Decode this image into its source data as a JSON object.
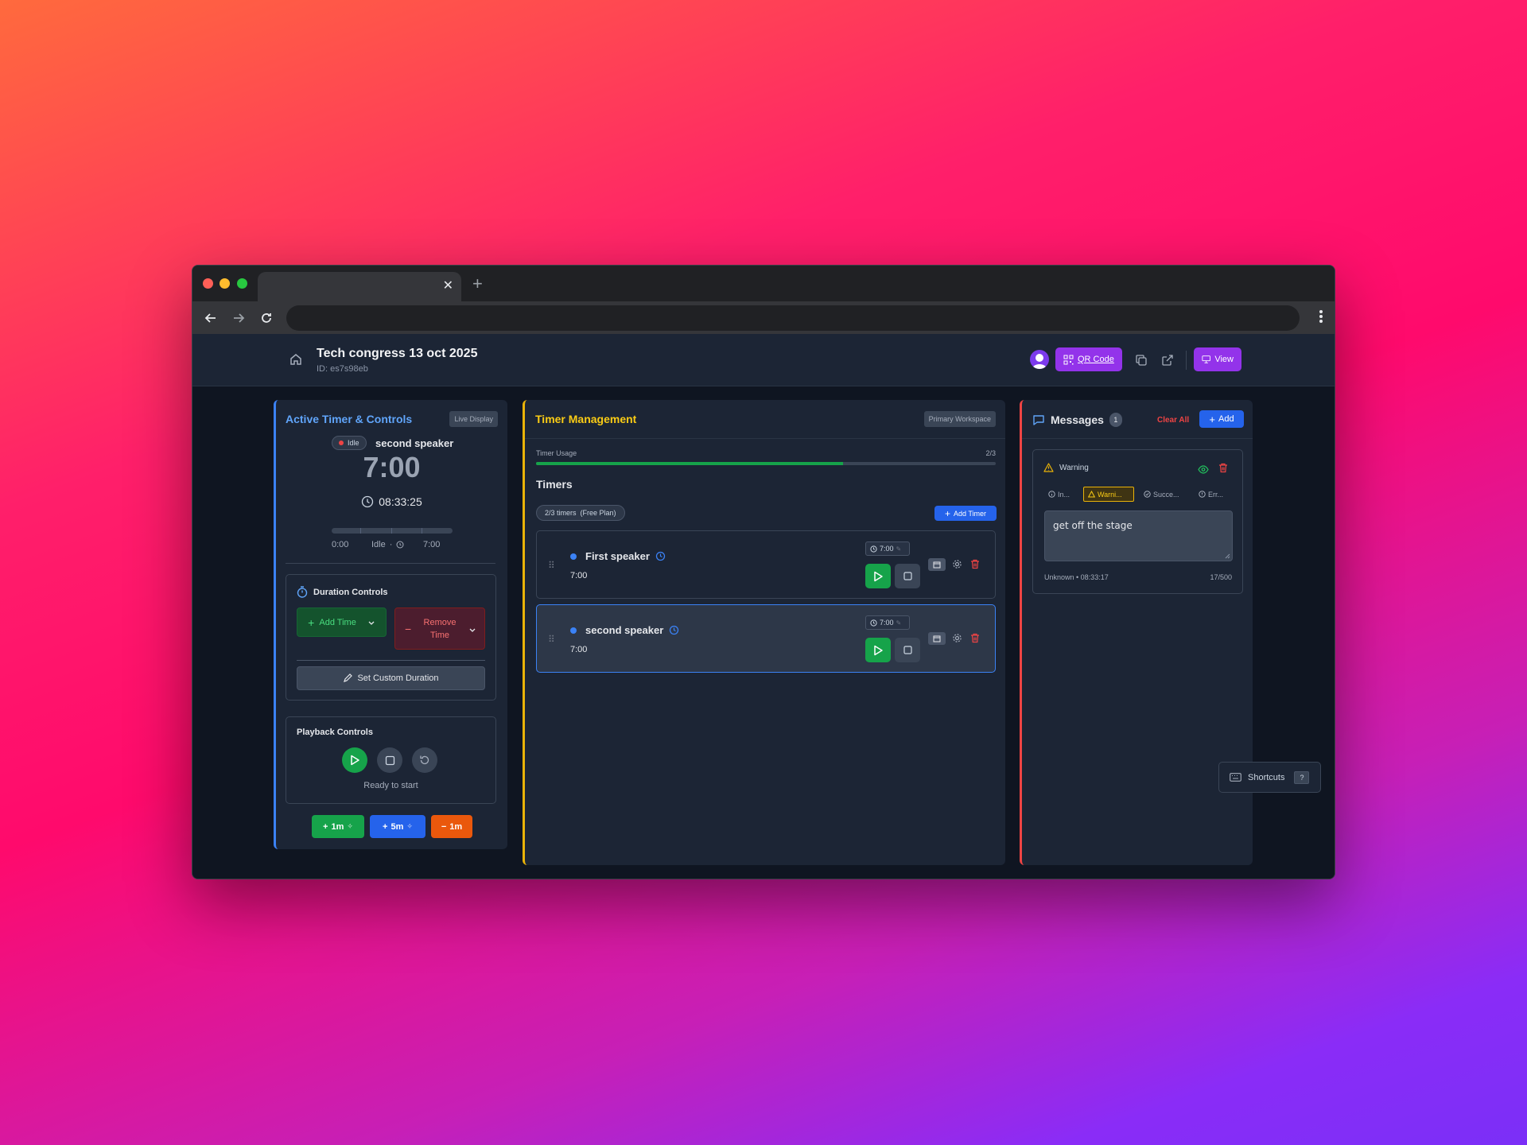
{
  "browser": {
    "tab_close": "✕",
    "new_tab": "+"
  },
  "header": {
    "event_title": "Tech congress 13 oct 2025",
    "event_id": "ID: es7s98eb",
    "qr_label": "QR Code",
    "view_label": "View"
  },
  "left": {
    "title": "Active Timer & Controls",
    "badge": "Live Display",
    "status": "Idle",
    "speaker": "second speaker",
    "time": "7:00",
    "clock": "08:33:25",
    "progress": 0,
    "start_label": "0:00",
    "mid_label": "Idle",
    "dot_sep": "·",
    "end_label": "7:00",
    "duration": {
      "title": "Duration Controls",
      "add_time": "Add Time",
      "remove_time_1": "Remove",
      "remove_time_2": "Time",
      "custom": "Set Custom Duration"
    },
    "playback": {
      "title": "Playback Controls",
      "status": "Ready to start"
    },
    "quick": [
      {
        "sign": "+",
        "label": "1m"
      },
      {
        "sign": "+",
        "label": "5m"
      },
      {
        "sign": "−",
        "label": "1m"
      }
    ]
  },
  "mid": {
    "title": "Timer Management",
    "badge": "Primary Workspace",
    "usage_label": "Timer Usage",
    "usage_value": "2/3",
    "usage_fraction": 0.667,
    "timers_heading": "Timers",
    "count_chip": "2/3 timers  (Free Plan)",
    "add_timer": "Add Timer",
    "timers": [
      {
        "name": "First speaker",
        "duration": "7:00",
        "chip": "7:00",
        "active": false
      },
      {
        "name": "second speaker",
        "duration": "7:00",
        "chip": "7:00",
        "active": true
      }
    ]
  },
  "right": {
    "title": "Messages",
    "count": "1",
    "clear_all": "Clear All",
    "add": "Add",
    "message": {
      "type": "Warning",
      "tabs": [
        "In...",
        "Warni...",
        "Succe...",
        "Err..."
      ],
      "text": "get off the stage",
      "author_time": "Unknown • 08:33:17",
      "char_count": "17/500"
    }
  },
  "shortcuts": {
    "label": "Shortcuts",
    "key": "?"
  },
  "colors": {
    "accent_blue": "#3b82f6",
    "accent_yellow": "#eab308",
    "accent_red": "#ef4444",
    "green": "#16a34a",
    "purple": "#9333ea"
  }
}
